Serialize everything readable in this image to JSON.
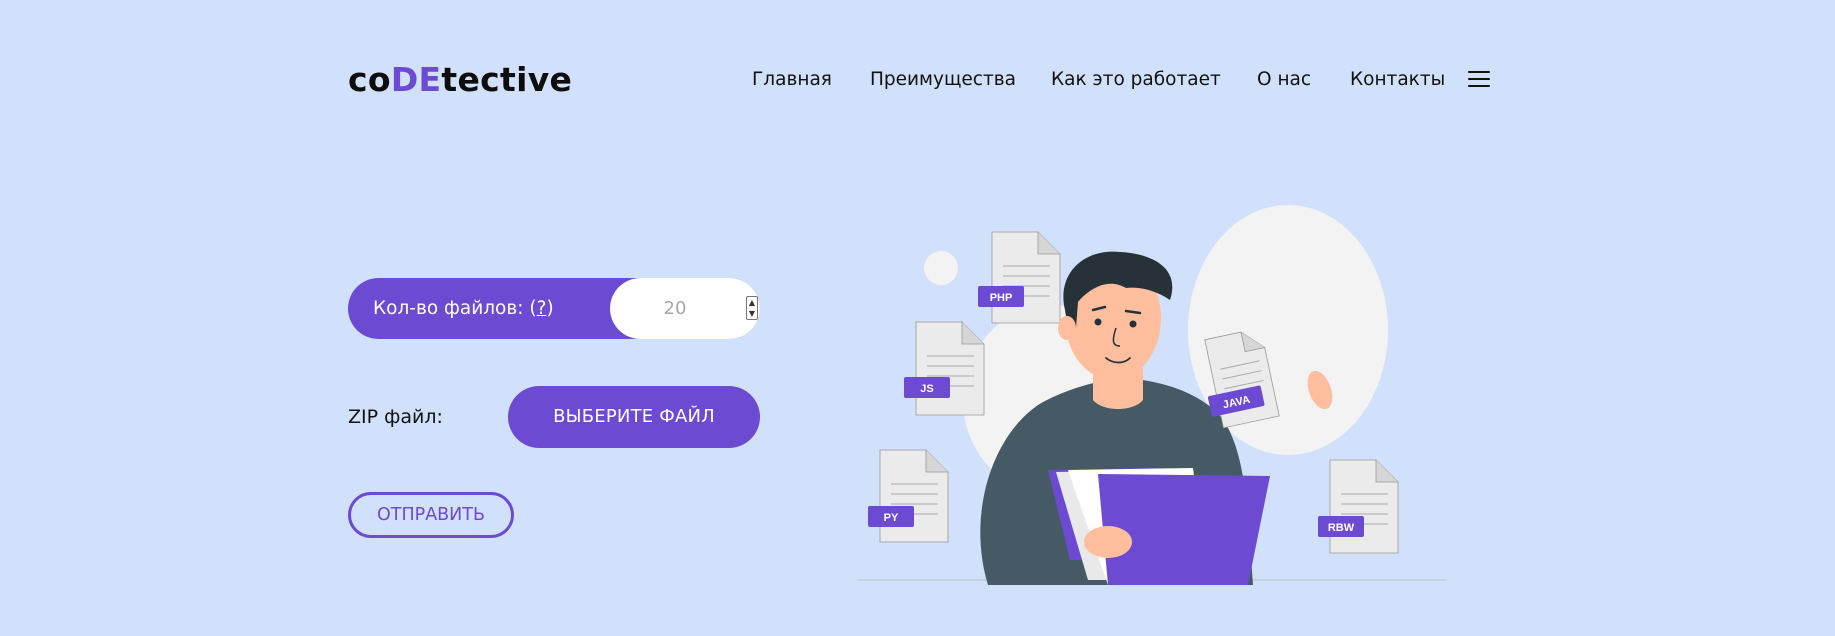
{
  "header": {
    "logo_prefix": "co",
    "logo_accent": "DE",
    "logo_suffix": "tective",
    "menu_icon": "hamburger-menu-icon"
  },
  "nav": {
    "items": [
      "Главная",
      "Преимущества",
      "Как это работает",
      "О нас",
      "Контакты"
    ]
  },
  "form": {
    "count_label": "Кол-во файлов: (",
    "count_help": "?",
    "count_label_end": ")",
    "count_placeholder": "20",
    "spinner_icon": "number-spinner-icon",
    "zip_label": "ZIP файл:",
    "file_button": "ВЫБЕРИТЕ ФАЙЛ",
    "submit_button": "ОТПРАВИТЬ"
  },
  "illustration": {
    "file_tags": [
      "PHP",
      "JS",
      "JAVA",
      "PY",
      "RBW"
    ]
  },
  "colors": {
    "background": "#d1e1fb",
    "accent": "#6d4ad2",
    "white": "#ffffff"
  }
}
